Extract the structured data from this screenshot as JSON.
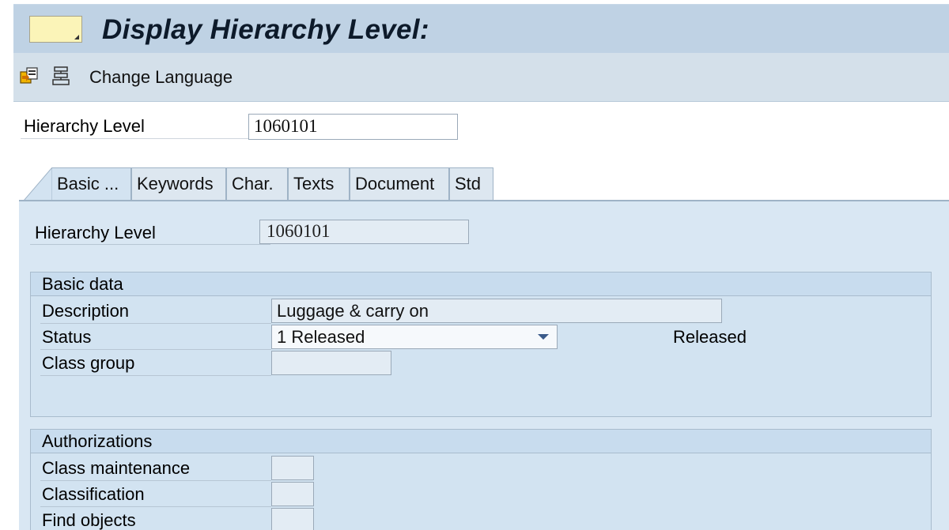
{
  "window": {
    "title": "Display Hierarchy Level:",
    "command_field_value": ""
  },
  "toolbar": {
    "icon1": "copy-object-icon",
    "icon2": "hierarchy-list-icon",
    "change_language_label": "Change Language"
  },
  "header": {
    "hierarchy_level_label": "Hierarchy Level",
    "hierarchy_level_value": "1060101"
  },
  "tabs": [
    {
      "label": "Basic ...",
      "active": true
    },
    {
      "label": "Keywords",
      "active": false
    },
    {
      "label": "Char.",
      "active": false
    },
    {
      "label": "Texts",
      "active": false
    },
    {
      "label": "Document",
      "active": false
    },
    {
      "label": "Std",
      "active": false
    }
  ],
  "panel": {
    "hierarchy_level_label": "Hierarchy Level",
    "hierarchy_level_value": "1060101",
    "basic_data": {
      "title": "Basic data",
      "description_label": "Description",
      "description_value": "Luggage & carry on",
      "status_label": "Status",
      "status_value": "1 Released",
      "status_text": "Released",
      "class_group_label": "Class group",
      "class_group_value": ""
    },
    "authorizations": {
      "title": "Authorizations",
      "class_maintenance_label": "Class maintenance",
      "class_maintenance_value": "",
      "classification_label": "Classification",
      "classification_value": "",
      "find_objects_label": "Find objects",
      "find_objects_value": ""
    }
  }
}
